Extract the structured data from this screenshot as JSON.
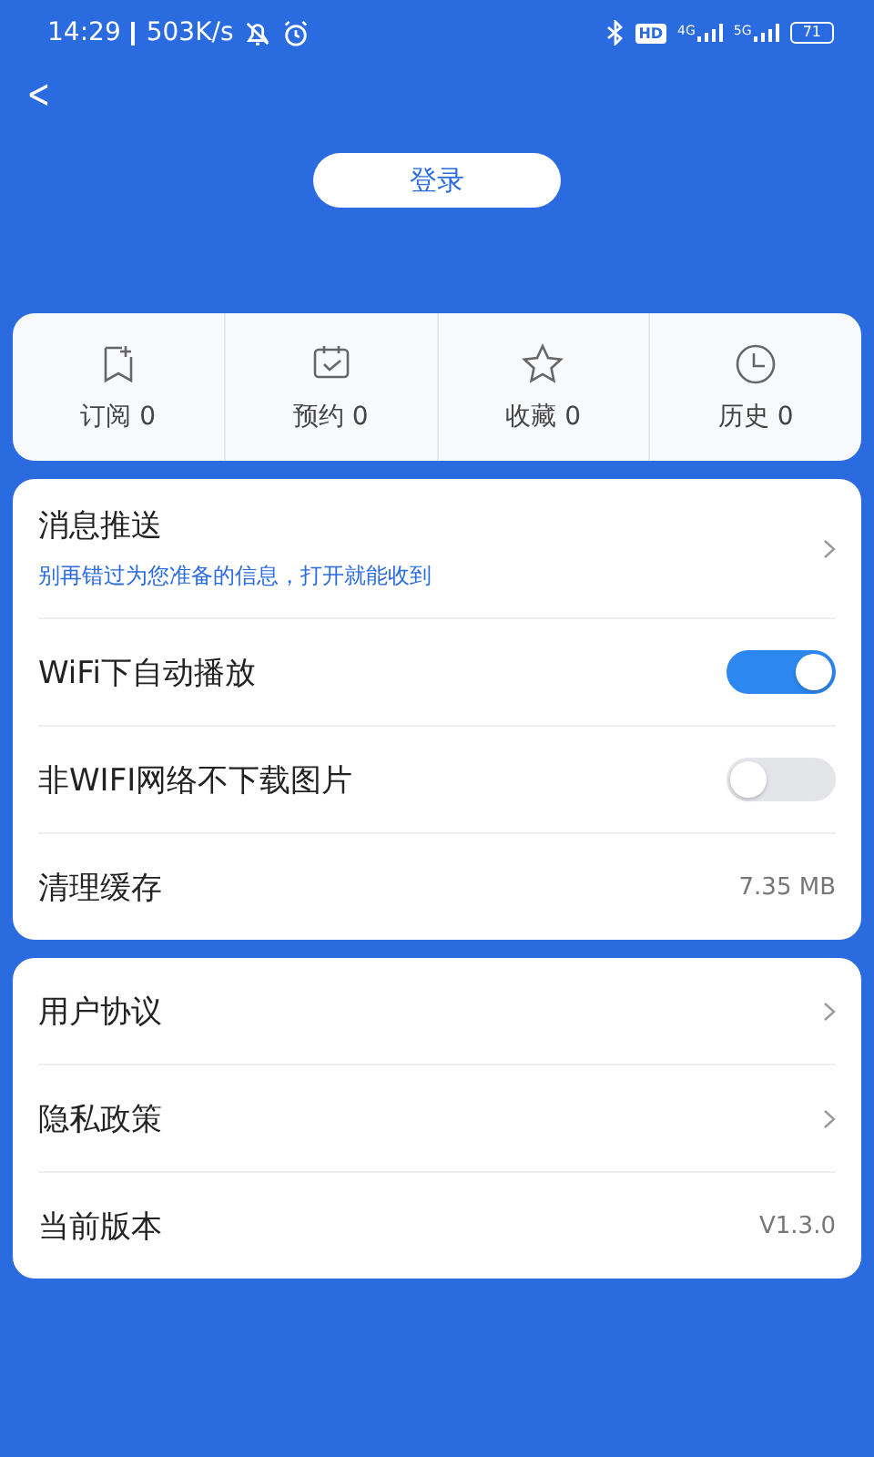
{
  "status_bar": {
    "time": "14:29",
    "speed": "503K/s",
    "hd": "HD",
    "networks": [
      "4G",
      "5G"
    ],
    "battery": "71"
  },
  "header": {
    "back": "<",
    "login": "登录"
  },
  "stats": [
    {
      "label": "订阅",
      "count": "0"
    },
    {
      "label": "预约",
      "count": "0"
    },
    {
      "label": "收藏",
      "count": "0"
    },
    {
      "label": "历史",
      "count": "0"
    }
  ],
  "settings": [
    {
      "kind": "link",
      "label": "消息推送",
      "subtitle": "别再错过为您准备的信息，打开就能收到"
    },
    {
      "kind": "toggle",
      "label": "WiFi下自动播放",
      "on": true
    },
    {
      "kind": "toggle",
      "label": "非WIFI网络不下载图片",
      "on": false
    },
    {
      "kind": "value",
      "label": "清理缓存",
      "value": "7.35 MB"
    }
  ],
  "about": [
    {
      "kind": "link",
      "label": "用户协议"
    },
    {
      "kind": "link",
      "label": "隐私政策"
    },
    {
      "kind": "value",
      "label": "当前版本",
      "value": "V1.3.0"
    }
  ]
}
